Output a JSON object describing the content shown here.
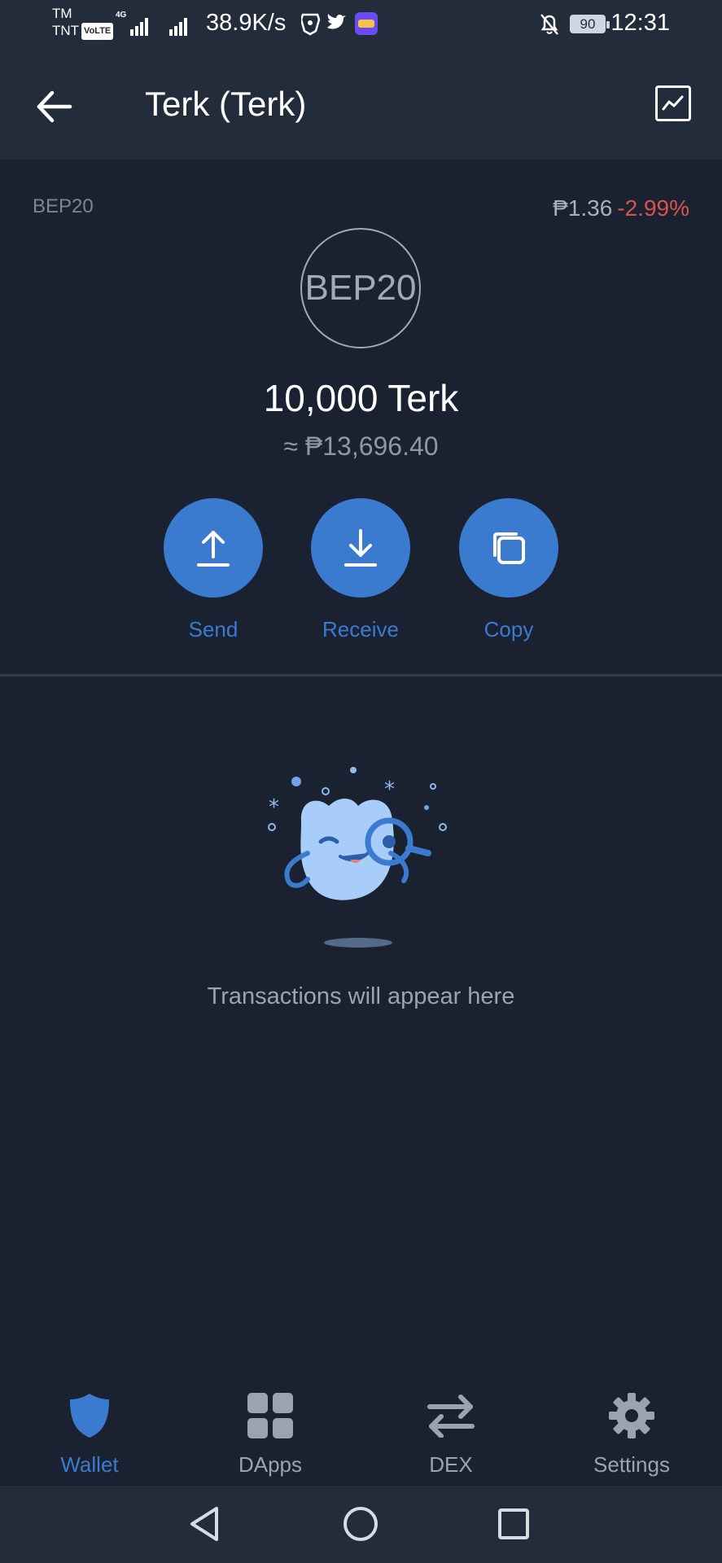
{
  "status_bar": {
    "carrier_top": "TM",
    "carrier_bottom": "TNT",
    "volte": "VoLTE",
    "network": "4G",
    "speed": "38.9K/s",
    "battery": "90",
    "time": "12:31"
  },
  "header": {
    "title": "Terk (Terk)"
  },
  "token": {
    "network": "BEP20",
    "price": "₱1.36",
    "change": "-2.99%",
    "logo_text": "BEP20",
    "balance": "10,000 Terk",
    "fiat_value": "≈ ₱13,696.40"
  },
  "actions": [
    {
      "label": "Send",
      "icon": "upload-arrow-icon"
    },
    {
      "label": "Receive",
      "icon": "download-arrow-icon"
    },
    {
      "label": "Copy",
      "icon": "copy-icon"
    }
  ],
  "empty_state": {
    "message": "Transactions will appear here"
  },
  "bottom_nav": [
    {
      "label": "Wallet",
      "icon": "shield-icon",
      "active": true
    },
    {
      "label": "DApps",
      "icon": "grid-icon",
      "active": false
    },
    {
      "label": "DEX",
      "icon": "swap-arrows-icon",
      "active": false
    },
    {
      "label": "Settings",
      "icon": "gear-icon",
      "active": false
    }
  ],
  "colors": {
    "accent": "#3a7bd0",
    "negative": "#d9534f",
    "background": "#1a2130",
    "header": "#232c3b"
  }
}
